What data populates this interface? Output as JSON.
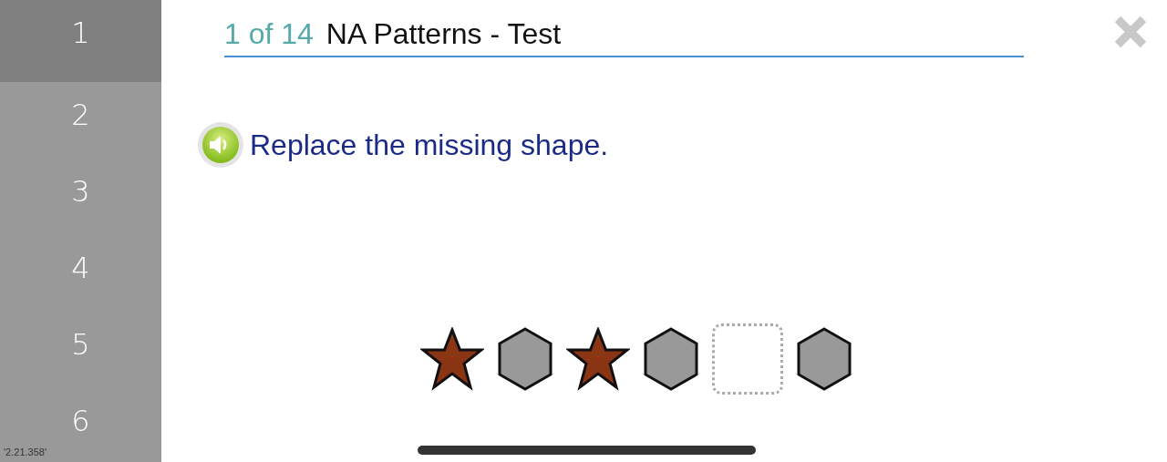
{
  "sidebar": {
    "items": [
      {
        "label": "1",
        "selected": true
      },
      {
        "label": "2",
        "selected": false
      },
      {
        "label": "3",
        "selected": false
      },
      {
        "label": "4",
        "selected": false
      },
      {
        "label": "5",
        "selected": false
      },
      {
        "label": "6",
        "selected": false
      }
    ],
    "version": "'2.21.358'"
  },
  "header": {
    "progress": "1 of 14",
    "title": "NA Patterns - Test"
  },
  "prompt": "Replace the missing shape.",
  "pattern": [
    {
      "kind": "star"
    },
    {
      "kind": "hexagon"
    },
    {
      "kind": "star"
    },
    {
      "kind": "hexagon"
    },
    {
      "kind": "blank"
    },
    {
      "kind": "hexagon"
    }
  ]
}
